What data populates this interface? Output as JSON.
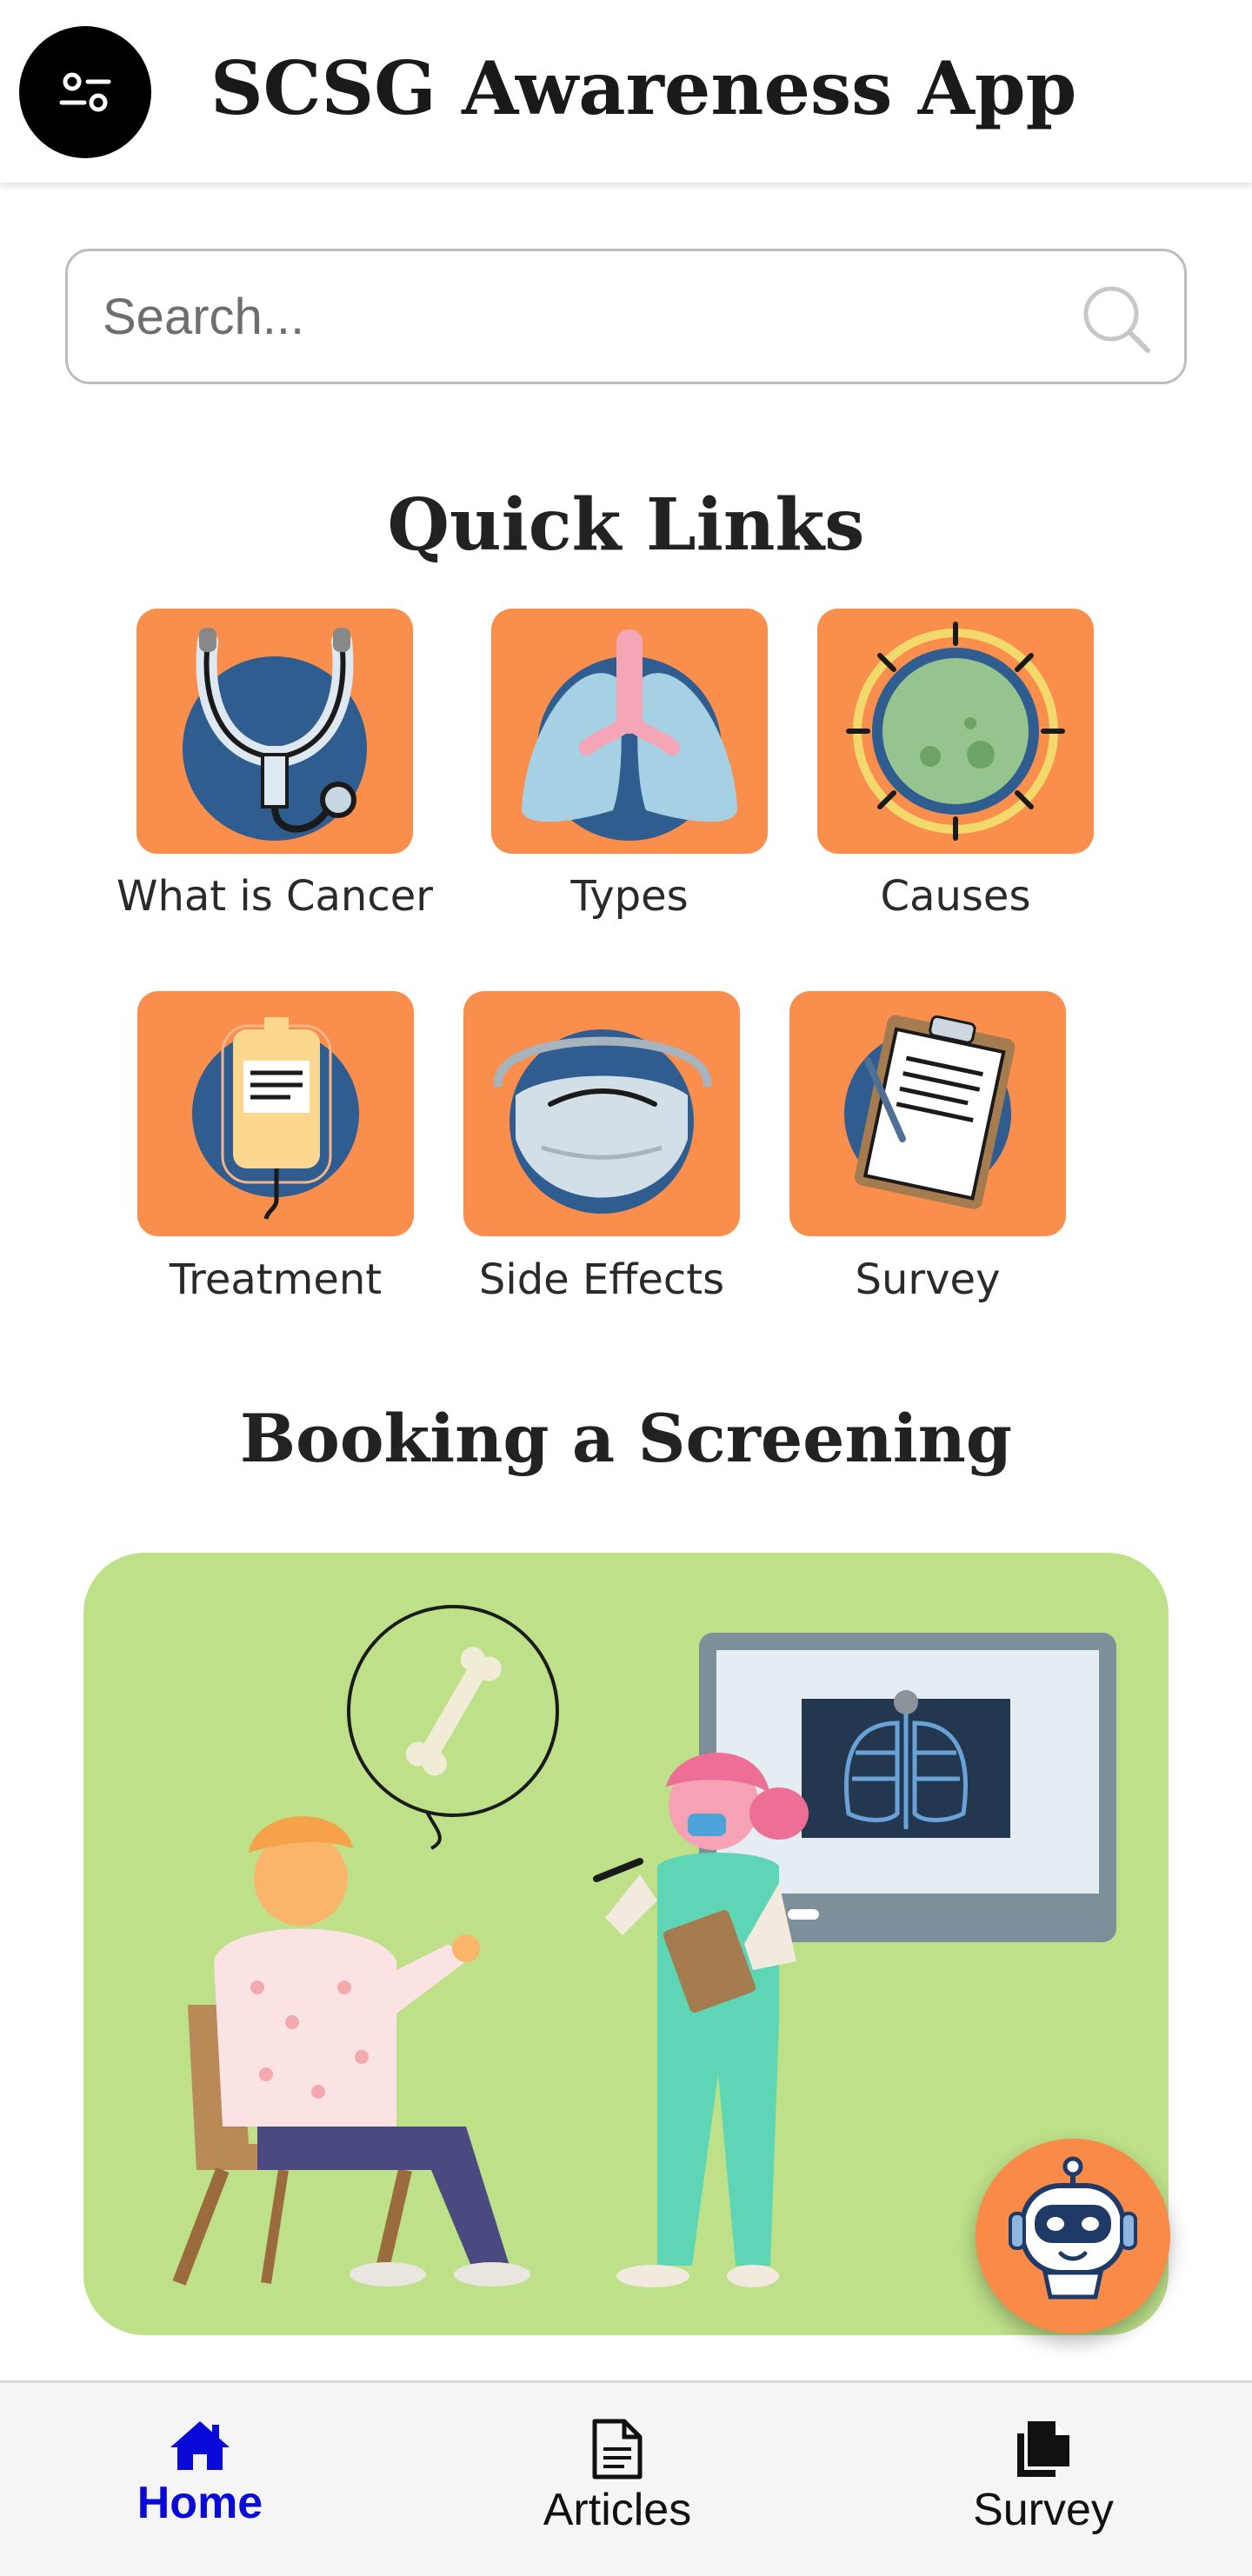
{
  "header": {
    "title": "SCSG Awareness App",
    "menu_icon": "menu-sliders-icon"
  },
  "search": {
    "placeholder": "Search...",
    "icon": "search-icon"
  },
  "quick_links": {
    "title": "Quick Links",
    "items": [
      {
        "label": "What is Cancer",
        "icon": "stethoscope-icon"
      },
      {
        "label": "Types",
        "icon": "lungs-icon"
      },
      {
        "label": "Causes",
        "icon": "virus-icon"
      },
      {
        "label": "Treatment",
        "icon": "iv-bag-icon"
      },
      {
        "label": "Side Effects",
        "icon": "face-mask-icon"
      },
      {
        "label": "Survey",
        "icon": "clipboard-icon"
      }
    ]
  },
  "booking": {
    "title": "Booking a Screening",
    "illustration": "doctor-consultation-illustration"
  },
  "chatbot": {
    "icon": "chatbot-robot-icon"
  },
  "bottom_nav": {
    "items": [
      {
        "label": "Home",
        "icon": "home-icon",
        "active": true
      },
      {
        "label": "Articles",
        "icon": "document-icon",
        "active": false
      },
      {
        "label": "Survey",
        "icon": "copy-documents-icon",
        "active": false
      }
    ]
  },
  "colors": {
    "tile_orange": "#fa8e4d",
    "booking_green": "#bde089",
    "active_nav": "#0a0ad8",
    "icon_navy": "#2f5d8f"
  }
}
